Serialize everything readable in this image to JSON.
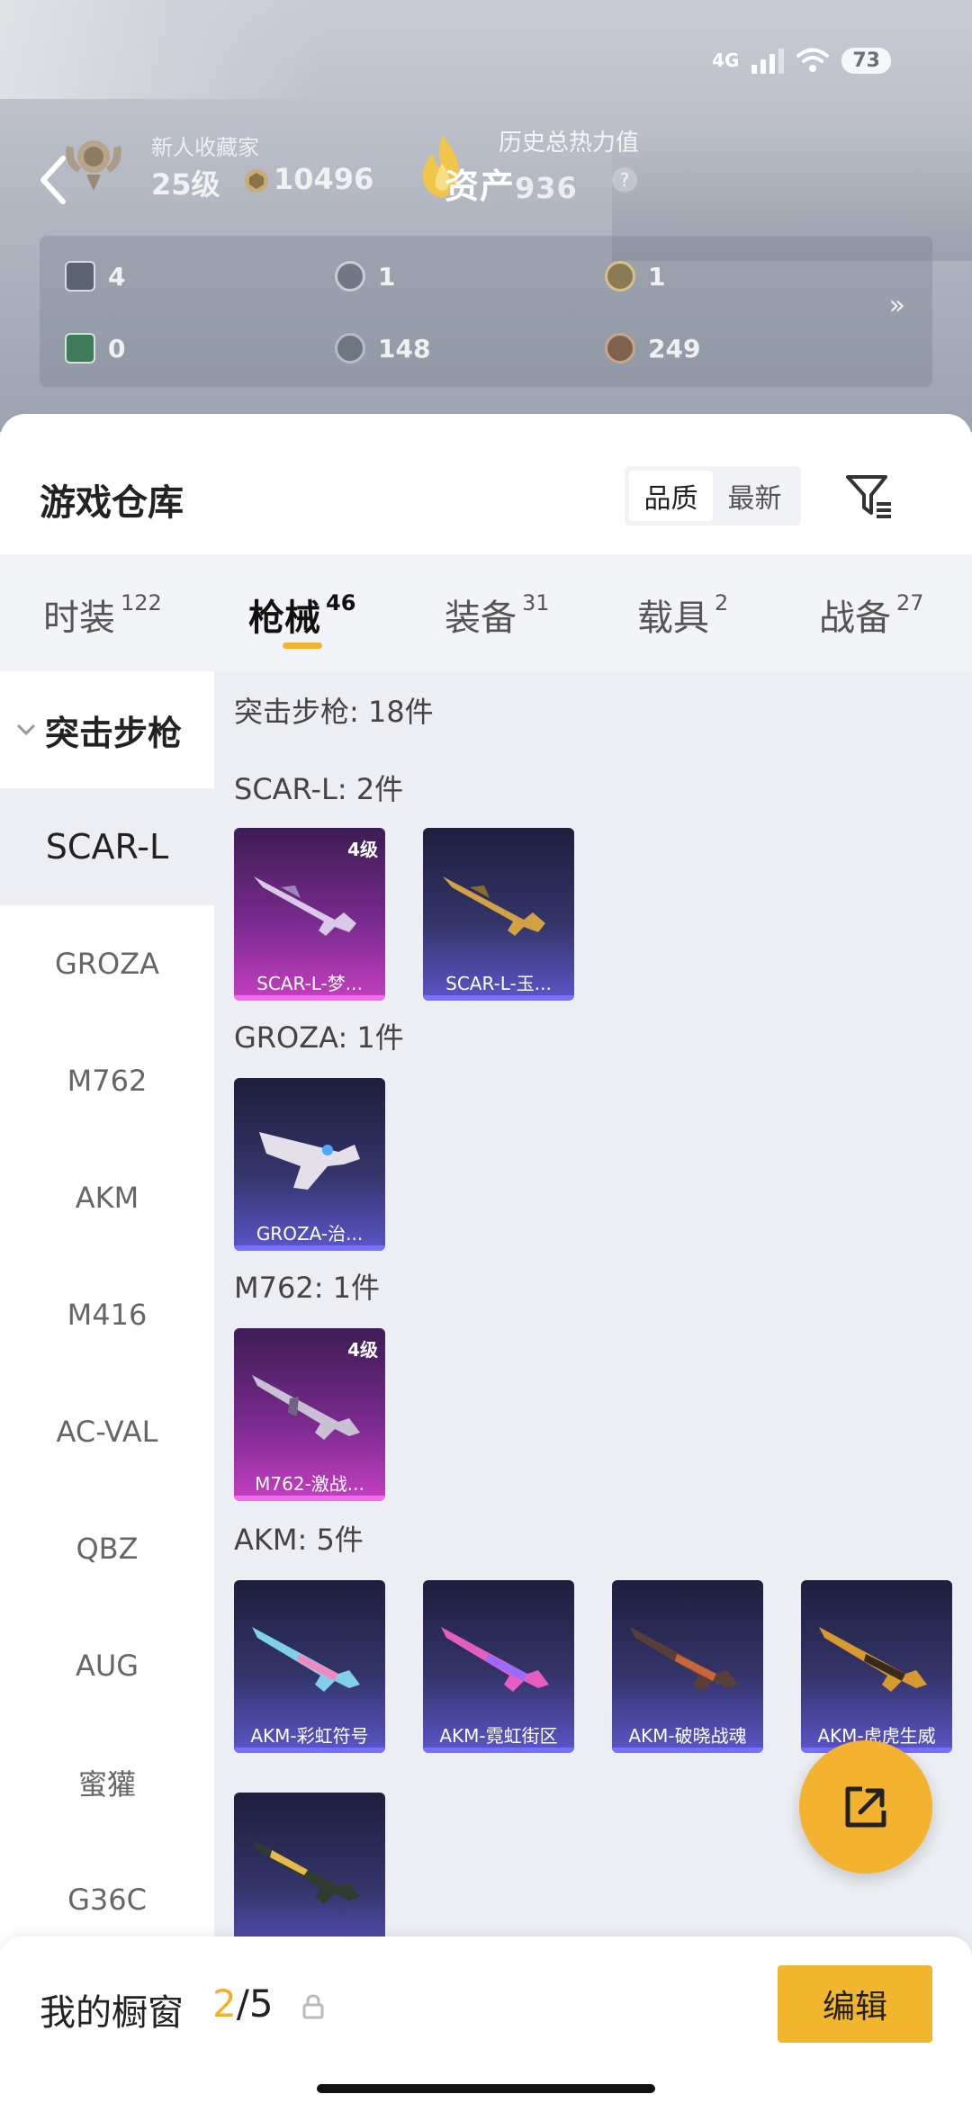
{
  "status_bar": {
    "network": "4G",
    "battery": "73"
  },
  "profile": {
    "rank_title": "新人收藏家",
    "level": "25级",
    "coins": "10496",
    "heat_label": "历史总热力值",
    "assets_text": "资产",
    "assets_value": "936",
    "question": "?"
  },
  "stats": [
    {
      "icon": "card-icon",
      "value": "4"
    },
    {
      "icon": "s-badge-icon",
      "value": "1"
    },
    {
      "icon": "gold-badge-icon",
      "value": "1"
    },
    {
      "icon": "green-card-icon",
      "value": "0"
    },
    {
      "icon": "silver-coin-icon",
      "value": "148"
    },
    {
      "icon": "bronze-coin-icon",
      "value": "249"
    }
  ],
  "stats_more": "»",
  "warehouse": {
    "title": "游戏仓库",
    "sort_options": [
      "品质",
      "最新"
    ],
    "sort_selected": "品质"
  },
  "tabs": [
    {
      "label": "时装",
      "count": "122"
    },
    {
      "label": "枪械",
      "count": "46"
    },
    {
      "label": "装备",
      "count": "31"
    },
    {
      "label": "载具",
      "count": "2"
    },
    {
      "label": "战备",
      "count": "27"
    }
  ],
  "active_tab": "枪械",
  "sidebar": {
    "group": "突击步枪",
    "items": [
      "SCAR-L",
      "GROZA",
      "M762",
      "AKM",
      "M416",
      "AC-VAL",
      "QBZ",
      "AUG",
      "蜜獾",
      "G36C"
    ],
    "active": "SCAR-L"
  },
  "content": {
    "category_summary": "突击步枪: 18件",
    "sections": [
      {
        "title": "SCAR-L: 2件",
        "items": [
          {
            "name": "SCAR-L-梦...",
            "level": "4级",
            "rarity": "purple"
          },
          {
            "name": "SCAR-L-玉...",
            "level": "",
            "rarity": "blue"
          }
        ]
      },
      {
        "title": "GROZA: 1件",
        "items": [
          {
            "name": "GROZA-治...",
            "level": "",
            "rarity": "blue"
          }
        ]
      },
      {
        "title": "M762: 1件",
        "items": [
          {
            "name": "M762-激战...",
            "level": "4级",
            "rarity": "purple"
          }
        ]
      },
      {
        "title": "AKM: 5件",
        "items": [
          {
            "name": "AKM-彩虹符号",
            "level": "",
            "rarity": "blue"
          },
          {
            "name": "AKM-霓虹街区",
            "level": "",
            "rarity": "blue"
          },
          {
            "name": "AKM-破晓战魂",
            "level": "",
            "rarity": "blue"
          },
          {
            "name": "AKM-虎虎生威",
            "level": "",
            "rarity": "blue"
          },
          {
            "name": "",
            "level": "",
            "rarity": "blue"
          }
        ]
      }
    ]
  },
  "footer": {
    "showcase_label": "我的橱窗",
    "showcase_current": "2",
    "showcase_total": "/5",
    "edit_label": "编辑"
  },
  "colors": {
    "accent": "#f2b62e",
    "purple_rarity": "#c43fc1",
    "blue_rarity": "#5b56c8"
  }
}
